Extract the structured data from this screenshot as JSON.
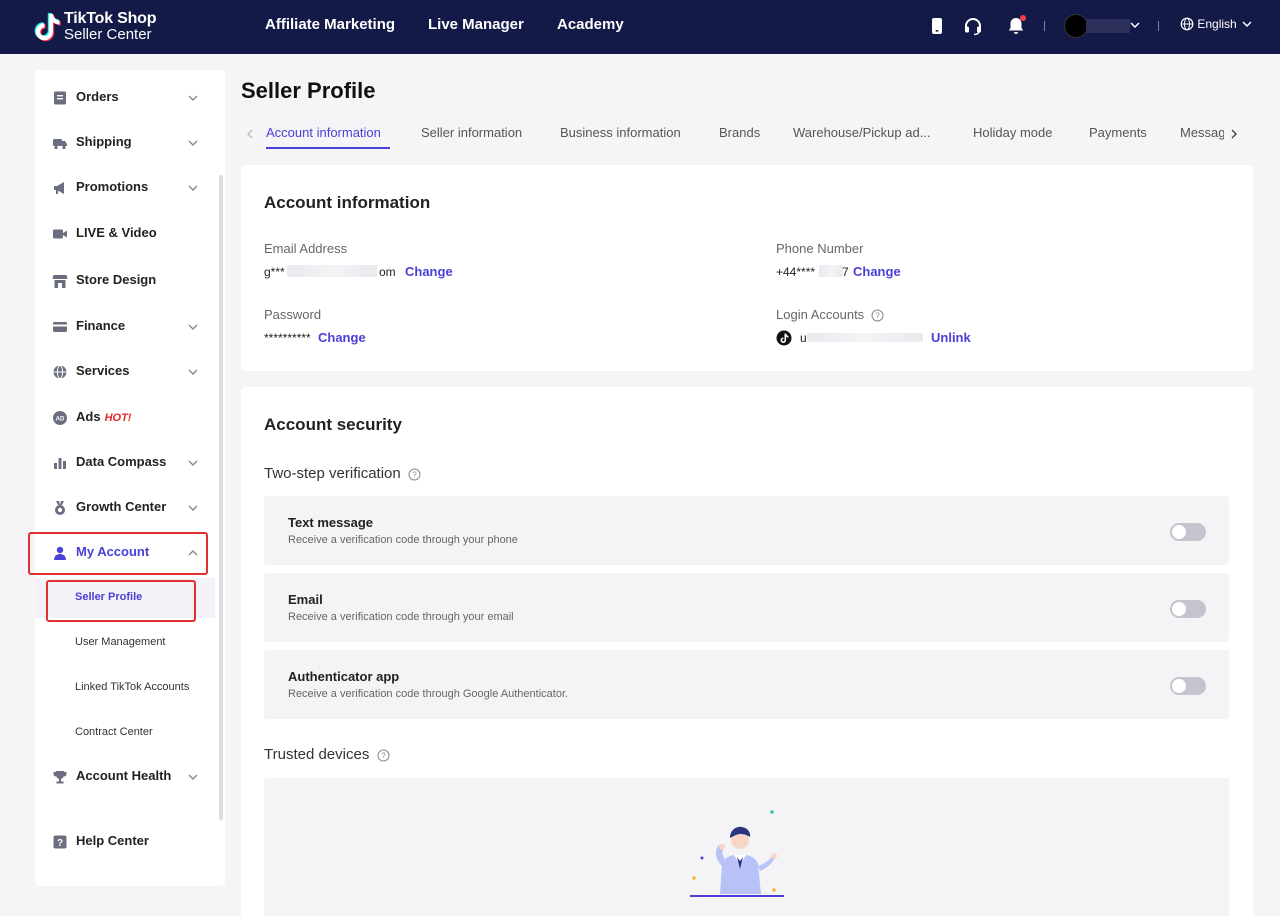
{
  "header": {
    "logo_line1": "TikTok Shop",
    "logo_line2": "Seller Center",
    "nav": [
      "Affiliate Marketing",
      "Live Manager",
      "Academy"
    ],
    "language": "English",
    "icons": [
      "phone-icon",
      "headset-icon",
      "bell-icon",
      "globe-icon"
    ]
  },
  "sidebar": {
    "items": [
      {
        "label": "Orders",
        "icon": "orders-icon"
      },
      {
        "label": "Shipping",
        "icon": "truck-icon"
      },
      {
        "label": "Promotions",
        "icon": "megaphone-icon"
      },
      {
        "label": "LIVE & Video",
        "icon": "video-icon"
      },
      {
        "label": "Store Design",
        "icon": "store-icon"
      },
      {
        "label": "Finance",
        "icon": "card-icon"
      },
      {
        "label": "Services",
        "icon": "globe-icon"
      },
      {
        "label": "Ads",
        "icon": "ads-icon",
        "badge": "HOT!"
      },
      {
        "label": "Data Compass",
        "icon": "bar-chart-icon"
      },
      {
        "label": "Growth Center",
        "icon": "medal-icon"
      },
      {
        "label": "My Account",
        "icon": "user-icon"
      },
      {
        "label": "Account Health",
        "icon": "trophy-icon"
      },
      {
        "label": "Help Center",
        "icon": "help-icon"
      }
    ],
    "sub_items": [
      "Seller Profile",
      "User Management",
      "Linked TikTok Accounts",
      "Contract Center"
    ]
  },
  "main": {
    "title": "Seller Profile",
    "tabs": [
      "Account information",
      "Seller information",
      "Business information",
      "Brands",
      "Warehouse/Pickup ad...",
      "Holiday mode",
      "Payments",
      "Messag"
    ],
    "account_info": {
      "title": "Account information",
      "email_label": "Email Address",
      "email_prefix": "g***",
      "email_suffix": "om",
      "phone_label": "Phone Number",
      "phone_prefix": "+44****",
      "phone_suffix": "7",
      "password_label": "Password",
      "password_value": "**********",
      "login_label": "Login Accounts",
      "login_prefix": "u",
      "change": "Change",
      "unlink": "Unlink"
    },
    "security": {
      "title": "Account security",
      "two_step": "Two-step verification",
      "options": [
        {
          "title": "Text message",
          "desc": "Receive a verification code through your phone",
          "enabled": false
        },
        {
          "title": "Email",
          "desc": "Receive a verification code through your email",
          "enabled": false
        },
        {
          "title": "Authenticator app",
          "desc": "Receive a verification code through Google Authenticator.",
          "enabled": false
        }
      ],
      "trusted": "Trusted devices"
    }
  },
  "colors": {
    "topbar": "#141a48",
    "accent": "#4a3fd6",
    "highlight": "#e0302f",
    "hot": "#e8262d"
  }
}
